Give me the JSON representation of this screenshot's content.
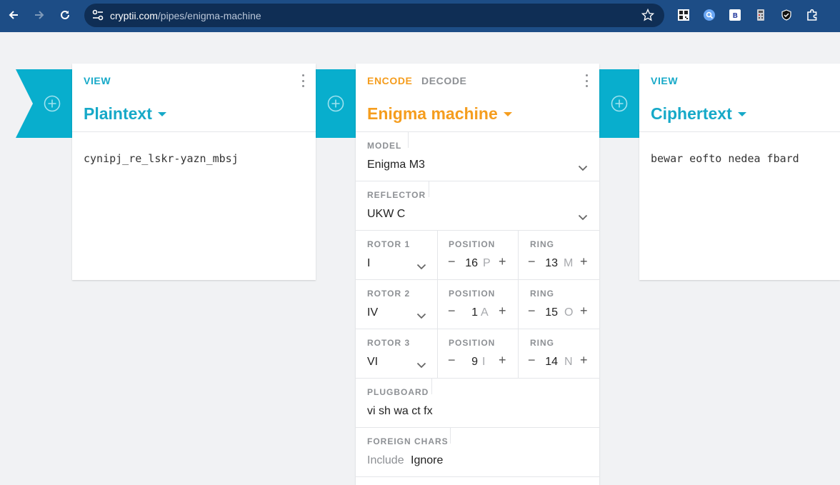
{
  "browser": {
    "url_domain": "cryptii.com",
    "url_path": "/pipes/enigma-machine"
  },
  "plaintext_card": {
    "tab_label": "VIEW",
    "title": "Plaintext",
    "content": "cynipj_re_lskr-yazn_mbsj"
  },
  "enigma_card": {
    "encode_label": "ENCODE",
    "decode_label": "DECODE",
    "title": "Enigma machine",
    "model": {
      "label": "MODEL",
      "value": "Enigma M3"
    },
    "reflector": {
      "label": "REFLECTOR",
      "value": "UKW C"
    },
    "rotors": [
      {
        "label": "ROTOR 1",
        "value": "I",
        "position_label": "POSITION",
        "position": "16",
        "position_letter": "P",
        "ring_label": "RING",
        "ring": "13",
        "ring_letter": "M"
      },
      {
        "label": "ROTOR 2",
        "value": "IV",
        "position_label": "POSITION",
        "position": "1",
        "position_letter": "A",
        "ring_label": "RING",
        "ring": "15",
        "ring_letter": "O"
      },
      {
        "label": "ROTOR 3",
        "value": "VI",
        "position_label": "POSITION",
        "position": "9",
        "position_letter": "I",
        "ring_label": "RING",
        "ring": "14",
        "ring_letter": "N"
      }
    ],
    "plugboard": {
      "label": "PLUGBOARD",
      "value": "vi sh wa ct fx"
    },
    "foreign_chars": {
      "label": "FOREIGN CHARS",
      "option_include": "Include",
      "option_ignore": "Ignore"
    }
  },
  "ciphertext_card": {
    "tab_label": "VIEW",
    "title": "Ciphertext",
    "content": "bewar eofto nedea fbard"
  },
  "colors": {
    "toolbar": "#1d4d86",
    "teal": "#16a9c8",
    "band": "#08aecd",
    "orange": "#f59d1e"
  },
  "icons": {
    "back": "arrow-left-icon",
    "forward": "arrow-right-icon",
    "reload": "reload-icon",
    "site_settings": "tune-icon",
    "bookmark": "star-icon",
    "add": "plus-circle-icon",
    "menu": "kebab-icon",
    "dropdown": "chevron-down-icon"
  }
}
